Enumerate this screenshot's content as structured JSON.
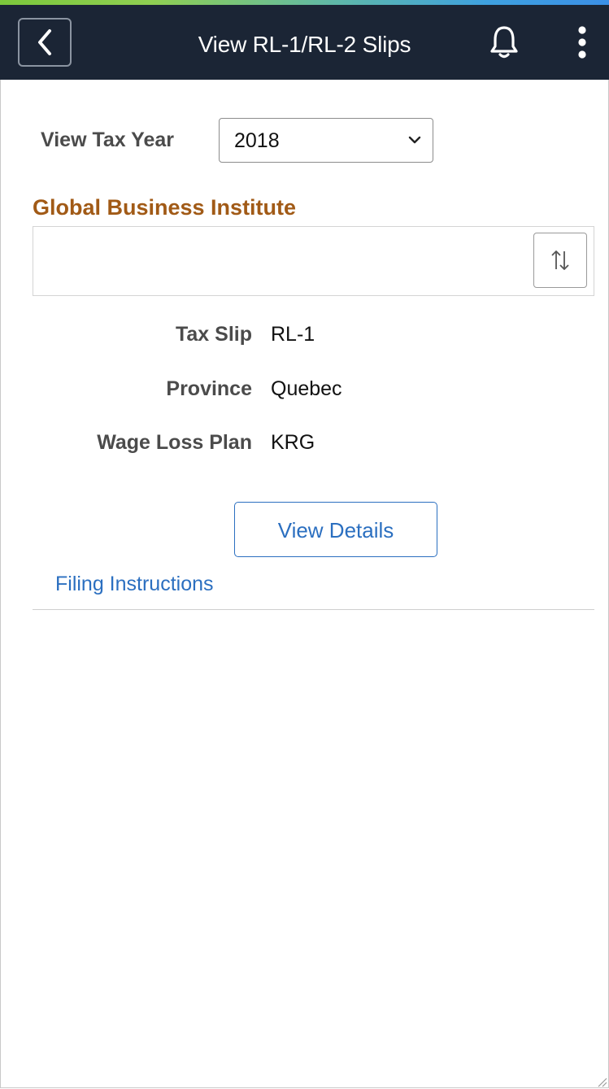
{
  "header": {
    "title": "View RL-1/RL-2 Slips",
    "back_icon": "chevron-left-icon",
    "notification_icon": "bell-icon",
    "menu_icon": "kebab-menu-icon",
    "background_color": "#1b2535"
  },
  "filter": {
    "tax_year_label": "View Tax Year",
    "tax_year_value": "2018"
  },
  "company": {
    "name": "Global Business Institute",
    "name_color": "#a15a16",
    "sort_icon": "sort-up-down-icon"
  },
  "slip": {
    "fields": [
      {
        "label": "Tax Slip",
        "value": "RL-1"
      },
      {
        "label": "Province",
        "value": "Quebec"
      },
      {
        "label": "Wage Loss Plan",
        "value": "KRG"
      }
    ],
    "view_details_label": "View Details"
  },
  "links": {
    "filing_instructions": "Filing Instructions",
    "link_color": "#2b6fc0"
  }
}
